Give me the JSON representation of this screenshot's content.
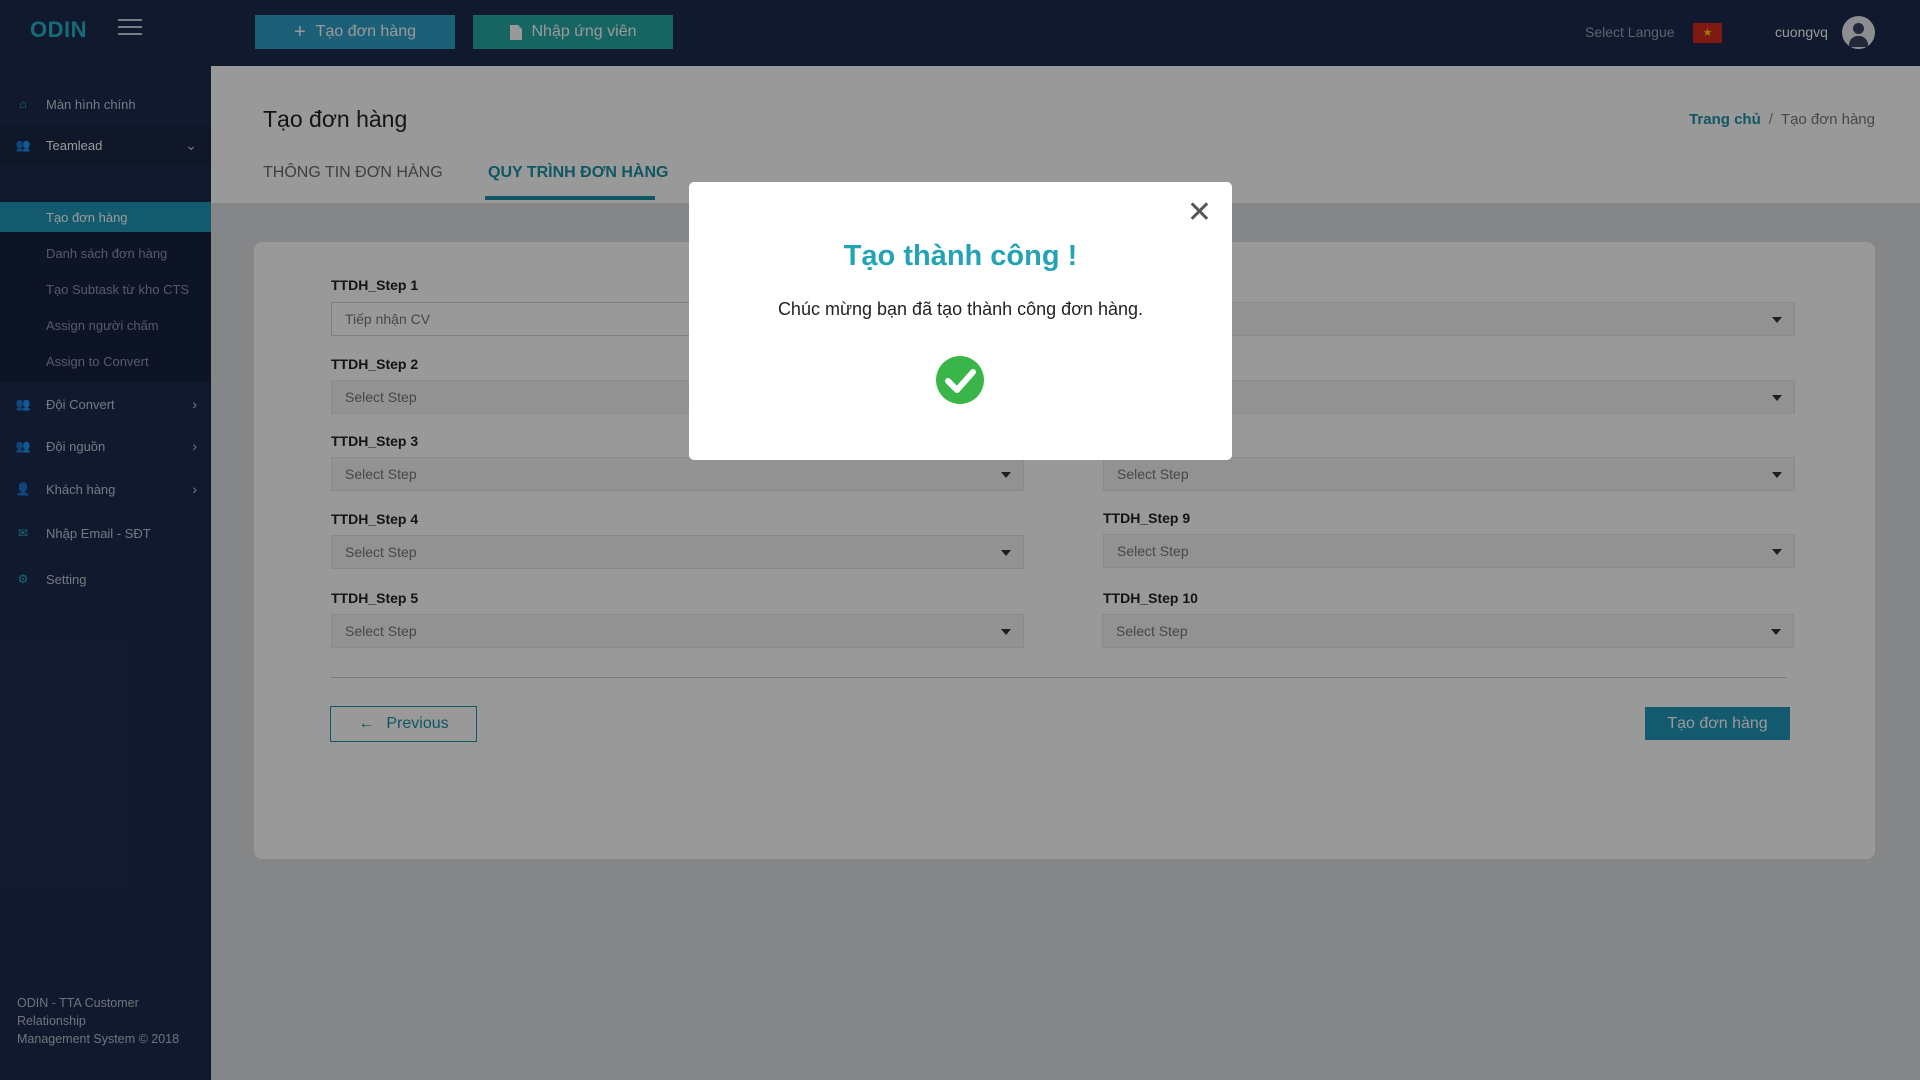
{
  "header": {
    "logo": "ODIN",
    "create_order_label": "Tạo đơn hàng",
    "import_candidate_label": "Nhập ứng viên",
    "select_language_label": "Select Langue",
    "flag_glyph": "★",
    "username": "cuongvq"
  },
  "sidebar": {
    "items": [
      {
        "label": "Màn hình chính",
        "icon": "home-icon"
      },
      {
        "label": "Teamlead",
        "icon": "people-icon"
      },
      {
        "label": "Đội Convert",
        "icon": "people-icon"
      },
      {
        "label": "Đội nguồn",
        "icon": "people-icon"
      },
      {
        "label": "Khách hàng",
        "icon": "person-icon"
      },
      {
        "label": "Nhập Email -  SĐT",
        "icon": "mail-icon"
      },
      {
        "label": "Setting",
        "icon": "gear-icon"
      }
    ],
    "subitems": [
      {
        "label": "Tạo đơn hàng",
        "active": true
      },
      {
        "label": "Danh sách đơn hàng"
      },
      {
        "label": "Tạo Subtask từ kho CTS"
      },
      {
        "label": "Assign người chấm"
      },
      {
        "label": "Assign to Convert"
      }
    ],
    "footer_line1": "ODIN - TTA Customer",
    "footer_line2": "Relationship",
    "footer_line3": "Management System © 2018"
  },
  "page": {
    "title": "Tạo đơn hàng",
    "breadcrumb_home": "Trang chủ",
    "breadcrumb_sep": "/",
    "breadcrumb_current": "Tạo đơn hàng",
    "tabs": [
      {
        "label": "THÔNG TIN ĐƠN HÀNG"
      },
      {
        "label": "QUY TRÌNH ĐƠN HÀNG",
        "active": true
      }
    ]
  },
  "steps": [
    {
      "label": "TTDH_Step 1",
      "value": "Tiếp nhận CV"
    },
    {
      "label": "TTDH_Step 2",
      "value": "Select Step"
    },
    {
      "label": "TTDH_Step 3",
      "value": "Select Step"
    },
    {
      "label": "TTDH_Step 4",
      "value": "Select Step"
    },
    {
      "label": "TTDH_Step 5",
      "value": "Select Step"
    },
    {
      "label": "",
      "value": ""
    },
    {
      "label": "",
      "value": ""
    },
    {
      "label": "",
      "value": "Select Step"
    },
    {
      "label": "TTDH_Step 9",
      "value": "Select Step"
    },
    {
      "label": "TTDH_Step 10",
      "value": "Select Step"
    }
  ],
  "actions": {
    "previous_label": "Previous",
    "submit_label": "Tạo đơn hàng"
  },
  "modal": {
    "close_glyph": "✕",
    "title": "Tạo thành công !",
    "message": "Chúc mừng bạn đã tạo thành công đơn hàng."
  },
  "colors": {
    "sidebar_bg": "#1d2b4f",
    "accent": "#1a91a6",
    "active_item": "#2196b8",
    "success": "#39b54a"
  }
}
